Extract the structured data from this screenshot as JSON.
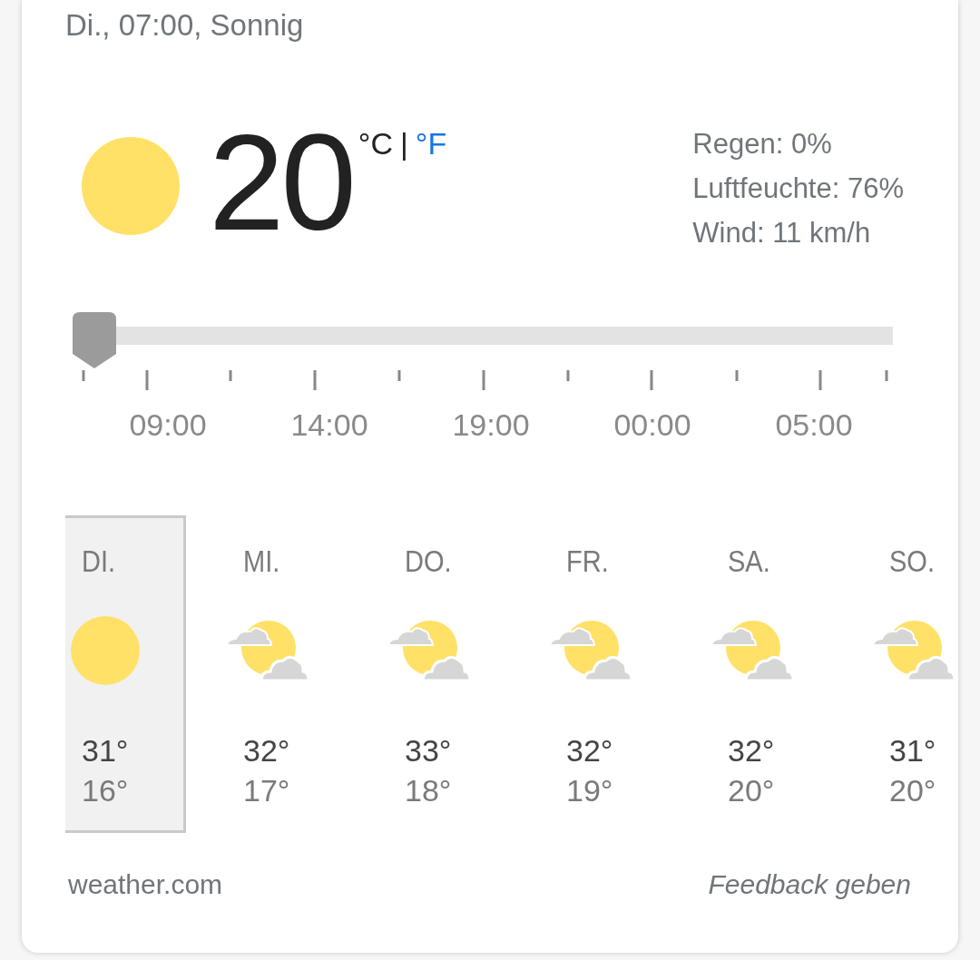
{
  "header": {
    "text": "Di., 07:00, Sonnig"
  },
  "current": {
    "kind": "sunny",
    "temperature": "20",
    "separator": "|",
    "units": [
      {
        "label": "°C",
        "selected": true
      },
      {
        "label": "°F",
        "selected": false
      }
    ],
    "details": [
      "Regen: 0%",
      "Luftfeuchte: 76%",
      "Wind: 11 km/h"
    ]
  },
  "timeline": {
    "level": 0,
    "labels": [
      "09:00",
      "14:00",
      "19:00",
      "00:00",
      "05:00"
    ]
  },
  "days": [
    {
      "day": "DI.",
      "kind": "sunny",
      "high": "31°",
      "low": "16°",
      "selected": true
    },
    {
      "day": "MI.",
      "kind": "partly_cloudy",
      "high": "32°",
      "low": "17°",
      "selected": false
    },
    {
      "day": "DO.",
      "kind": "partly_cloudy",
      "high": "33°",
      "low": "18°",
      "selected": false
    },
    {
      "day": "FR.",
      "kind": "partly_cloudy",
      "high": "32°",
      "low": "19°",
      "selected": false
    },
    {
      "day": "SA.",
      "kind": "partly_cloudy",
      "high": "32°",
      "low": "20°",
      "selected": false
    },
    {
      "day": "SO.",
      "kind": "partly_cloudy",
      "high": "31°",
      "low": "20°",
      "selected": false
    }
  ],
  "footer": {
    "source": "weather.com",
    "feedback": "Feedback geben"
  }
}
